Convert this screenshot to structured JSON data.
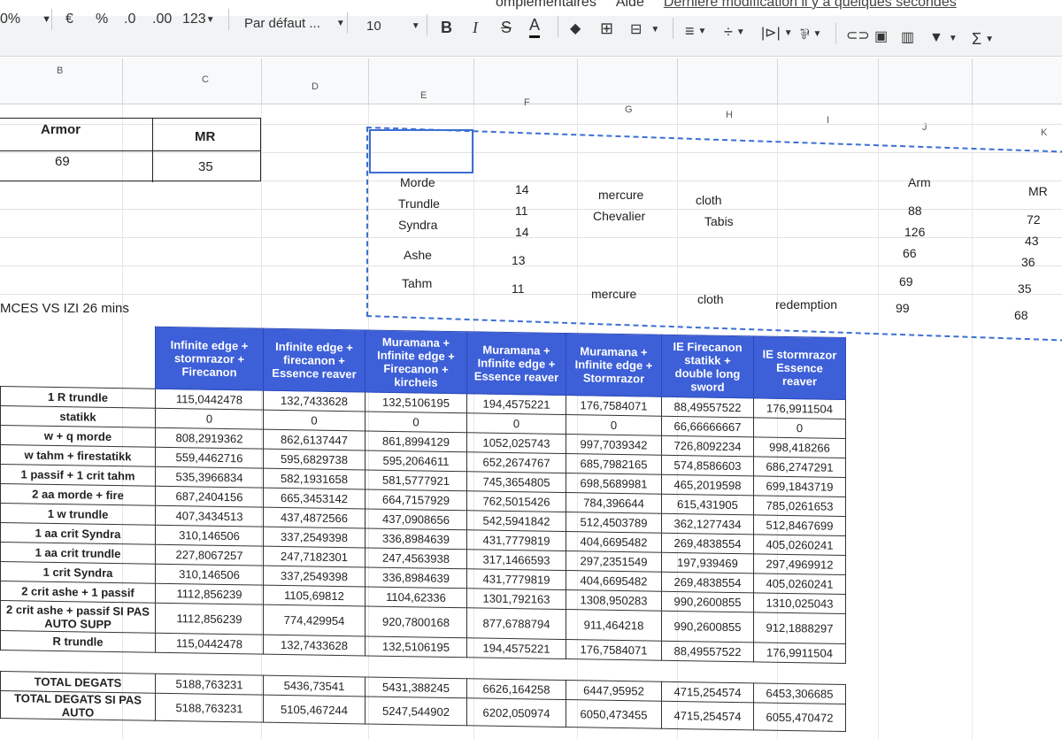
{
  "toolbar": {
    "zoom": "0%",
    "currency": "€",
    "percent": "%",
    "dec_less": ".0",
    "dec_more": ".00",
    "format_123": "123",
    "font": "Par défaut ...",
    "font_size": "10",
    "bold": "B",
    "italic": "I",
    "strike": "S",
    "text_color": "A",
    "sum": "Σ"
  },
  "menu": {
    "item1": "omplémentaires",
    "help": "Aide",
    "last_edit": "Dernière modification il y a quelques secondes"
  },
  "columns": [
    "B",
    "C",
    "D",
    "E",
    "F",
    "G",
    "H",
    "I",
    "J",
    "K"
  ],
  "armor_box": {
    "armor_label": "Armor",
    "mr_label": "MR",
    "armor_value": "69",
    "mr_value": "35"
  },
  "champ_block": {
    "arm_header": "Arm",
    "mr_header": "MR",
    "rows": [
      {
        "name": "Morde",
        "lvl": "14",
        "boots": "mercure",
        "item": "cloth",
        "extra": "",
        "arm": "88",
        "mr": "72"
      },
      {
        "name": "Trundle",
        "lvl": "11",
        "boots": "Chevalier",
        "item": "Tabis",
        "extra": "",
        "arm": "126",
        "mr": "43"
      },
      {
        "name": "Syndra",
        "lvl": "14",
        "boots": "",
        "item": "",
        "extra": "",
        "arm": "66",
        "mr": "36"
      },
      {
        "name": "Ashe",
        "lvl": "13",
        "boots": "",
        "item": "",
        "extra": "",
        "arm": "69",
        "mr": "35"
      },
      {
        "name": "Tahm",
        "lvl": "11",
        "boots": "mercure",
        "item": "cloth",
        "extra": "redemption",
        "arm": "99",
        "mr": "68"
      }
    ]
  },
  "section_title": "MCES VS IZI 26 mins",
  "main_table": {
    "headers": [
      "Infinite edge + stormrazor + Firecanon",
      "Infinite edge + firecanon + Essence reaver",
      "Muramana + Infinite edge + Firecanon + kircheis",
      "Muramana + Infinite edge + Essence reaver",
      "Muramana + Infinite edge + Stormrazor",
      "IE Firecanon statikk + double long sword",
      "IE stormrazor Essence reaver"
    ],
    "rows": [
      {
        "label": "1 R trundle",
        "values": [
          "115,0442478",
          "132,7433628",
          "132,5106195",
          "194,4575221",
          "176,7584071",
          "88,49557522",
          "176,9911504"
        ]
      },
      {
        "label": "statikk",
        "values": [
          "0",
          "0",
          "0",
          "0",
          "0",
          "66,66666667",
          "0"
        ]
      },
      {
        "label": "w + q morde",
        "values": [
          "808,2919362",
          "862,6137447",
          "861,8994129",
          "1052,025743",
          "997,7039342",
          "726,8092234",
          "998,418266"
        ]
      },
      {
        "label": "w tahm + firestatikk",
        "values": [
          "559,4462716",
          "595,6829738",
          "595,2064611",
          "652,2674767",
          "685,7982165",
          "574,8586603",
          "686,2747291"
        ]
      },
      {
        "label": "1 passif + 1 crit tahm",
        "values": [
          "535,3966834",
          "582,1931658",
          "581,5777921",
          "745,3654805",
          "698,5689981",
          "465,2019598",
          "699,1843719"
        ]
      },
      {
        "label": "2 aa morde + fire",
        "values": [
          "687,2404156",
          "665,3453142",
          "664,7157929",
          "762,5015426",
          "784,396644",
          "615,431905",
          "785,0261653"
        ]
      },
      {
        "label": "1 w trundle",
        "values": [
          "407,3434513",
          "437,4872566",
          "437,0908656",
          "542,5941842",
          "512,4503789",
          "362,1277434",
          "512,8467699"
        ]
      },
      {
        "label": "1 aa crit Syndra",
        "values": [
          "310,146506",
          "337,2549398",
          "336,8984639",
          "431,7779819",
          "404,6695482",
          "269,4838554",
          "405,0260241"
        ]
      },
      {
        "label": "1 aa crit trundle",
        "values": [
          "227,8067257",
          "247,7182301",
          "247,4563938",
          "317,1466593",
          "297,2351549",
          "197,939469",
          "297,4969912"
        ]
      },
      {
        "label": "1 crit Syndra",
        "values": [
          "310,146506",
          "337,2549398",
          "336,8984639",
          "431,7779819",
          "404,6695482",
          "269,4838554",
          "405,0260241"
        ]
      },
      {
        "label": "2 crit ashe + 1 passif",
        "values": [
          "1112,856239",
          "1105,69812",
          "1104,62336",
          "1301,792163",
          "1308,950283",
          "990,2600855",
          "1310,025043"
        ]
      },
      {
        "label": "2 crit ashe + passif SI PAS AUTO SUPP",
        "values": [
          "1112,856239",
          "774,429954",
          "920,7800168",
          "877,6788794",
          "911,464218",
          "990,2600855",
          "912,1888297"
        ]
      },
      {
        "label": "R trundle",
        "values": [
          "115,0442478",
          "132,7433628",
          "132,5106195",
          "194,4575221",
          "176,7584071",
          "88,49557522",
          "176,9911504"
        ]
      }
    ]
  },
  "totals": {
    "rows": [
      {
        "label": "TOTAL DEGATS",
        "values": [
          "5188,763231",
          "5436,73541",
          "5431,388245",
          "6626,164258",
          "6447,95952",
          "4715,254574",
          "6453,306685"
        ]
      },
      {
        "label": "TOTAL DEGATS SI PAS AUTO",
        "values": [
          "5188,763231",
          "5105,467244",
          "5247,544902",
          "6202,050974",
          "6050,473455",
          "4715,254574",
          "6055,470472"
        ]
      }
    ]
  }
}
